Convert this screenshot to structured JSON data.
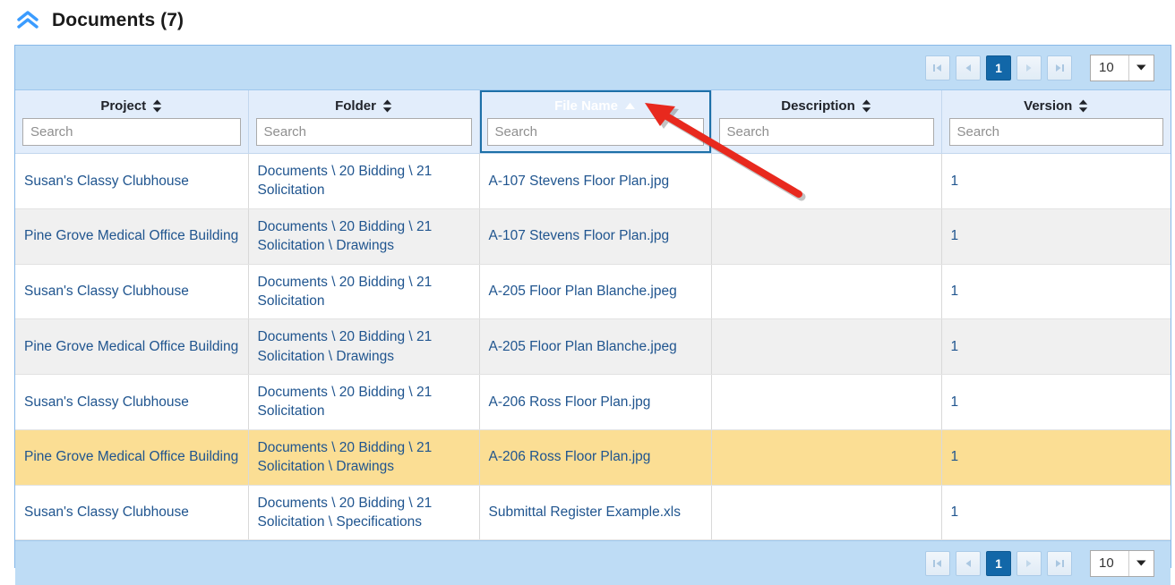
{
  "section": {
    "title": "Documents (7)",
    "collapse_icon": "double-chevron-up-icon",
    "accent_color": "#3B9CFF"
  },
  "pager": {
    "first_icon": "first-page-icon",
    "prev_icon": "previous-page-icon",
    "next_icon": "next-page-icon",
    "last_icon": "last-page-icon",
    "current_page": "1",
    "page_size": "10",
    "dropdown_icon": "chevron-down-icon",
    "active_color": "#1267A8",
    "band_color": "#BEDCF5"
  },
  "grid": {
    "columns": [
      {
        "label": "Project",
        "sort": "none",
        "search_placeholder": "Search",
        "search_value": ""
      },
      {
        "label": "Folder",
        "sort": "none",
        "search_placeholder": "Search",
        "search_value": ""
      },
      {
        "label": "File Name",
        "sort": "asc",
        "search_placeholder": "Search",
        "search_value": ""
      },
      {
        "label": "Description",
        "sort": "none",
        "search_placeholder": "Search",
        "search_value": ""
      },
      {
        "label": "Version",
        "sort": "none",
        "search_placeholder": "Search",
        "search_value": ""
      }
    ],
    "sorted_column_color": "#1D70A8",
    "header_band_color": "#E2EDFB",
    "alt_row_color": "#F0F0F0",
    "highlight_row_color": "#FBDE94",
    "link_color": "#20558F",
    "rows": [
      {
        "project": "Susan's Classy Clubhouse",
        "folder": "Documents \\ 20 Bidding \\ 21 Solicitation",
        "file_name": "A-107 Stevens Floor Plan.jpg",
        "description": "",
        "version": "1",
        "style": "normal"
      },
      {
        "project": "Pine Grove Medical Office Building",
        "folder": "Documents \\ 20 Bidding \\ 21 Solicitation \\ Drawings",
        "file_name": "A-107 Stevens Floor Plan.jpg",
        "description": "",
        "version": "1",
        "style": "alt"
      },
      {
        "project": "Susan's Classy Clubhouse",
        "folder": "Documents \\ 20 Bidding \\ 21 Solicitation",
        "file_name": "A-205 Floor Plan Blanche.jpeg",
        "description": "",
        "version": "1",
        "style": "normal"
      },
      {
        "project": "Pine Grove Medical Office Building",
        "folder": "Documents \\ 20 Bidding \\ 21 Solicitation \\ Drawings",
        "file_name": "A-205 Floor Plan Blanche.jpeg",
        "description": "",
        "version": "1",
        "style": "alt"
      },
      {
        "project": "Susan's Classy Clubhouse",
        "folder": "Documents \\ 20 Bidding \\ 21 Solicitation",
        "file_name": "A-206 Ross Floor Plan.jpg",
        "description": "",
        "version": "1",
        "style": "normal"
      },
      {
        "project": "Pine Grove Medical Office Building",
        "folder": "Documents \\ 20 Bidding \\ 21 Solicitation \\ Drawings",
        "file_name": "A-206 Ross Floor Plan.jpg",
        "description": "",
        "version": "1",
        "style": "highlight"
      },
      {
        "project": "Susan's Classy Clubhouse",
        "folder": "Documents \\ 20 Bidding \\ 21 Solicitation \\ Specifications",
        "file_name": "Submittal Register Example.xls",
        "description": "",
        "version": "1",
        "style": "normal"
      }
    ]
  },
  "annotation": {
    "type": "pointer-arrow",
    "color": "#E8291E",
    "points_to": "File Name"
  }
}
